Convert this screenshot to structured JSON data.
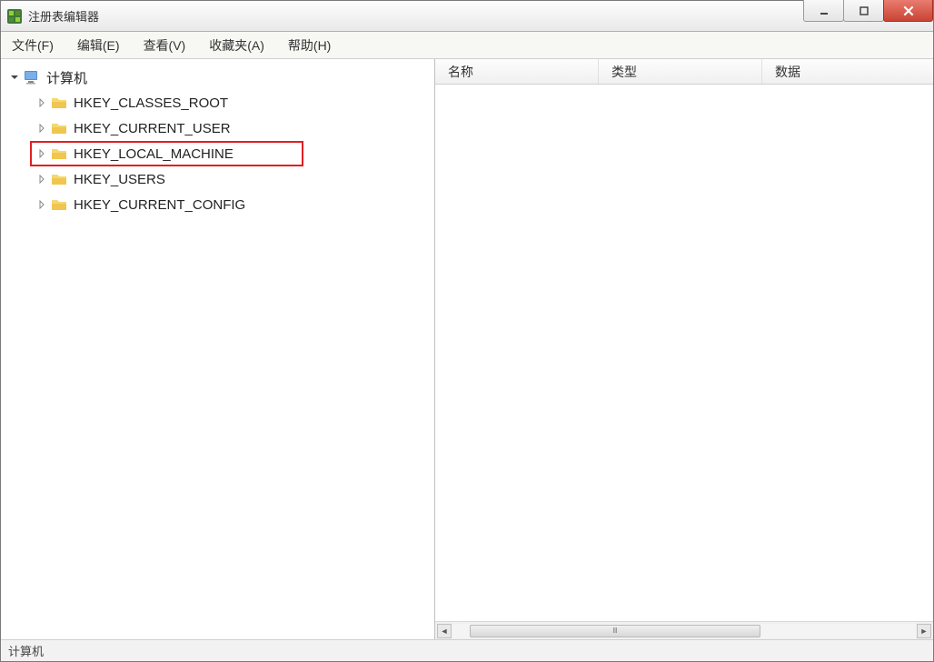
{
  "window": {
    "title": "注册表编辑器"
  },
  "menubar": {
    "items": [
      {
        "label": "文件(F)"
      },
      {
        "label": "编辑(E)"
      },
      {
        "label": "查看(V)"
      },
      {
        "label": "收藏夹(A)"
      },
      {
        "label": "帮助(H)"
      }
    ]
  },
  "tree": {
    "root": {
      "label": "计算机",
      "expanded": true
    },
    "children": [
      {
        "label": "HKEY_CLASSES_ROOT",
        "highlighted": false
      },
      {
        "label": "HKEY_CURRENT_USER",
        "highlighted": false
      },
      {
        "label": "HKEY_LOCAL_MACHINE",
        "highlighted": true
      },
      {
        "label": "HKEY_USERS",
        "highlighted": false
      },
      {
        "label": "HKEY_CURRENT_CONFIG",
        "highlighted": false
      }
    ]
  },
  "list": {
    "columns": {
      "name": "名称",
      "type": "类型",
      "data": "数据"
    }
  },
  "statusbar": {
    "path": "计算机"
  },
  "colors": {
    "highlight_border": "#e02020",
    "close_button": "#c94434"
  }
}
